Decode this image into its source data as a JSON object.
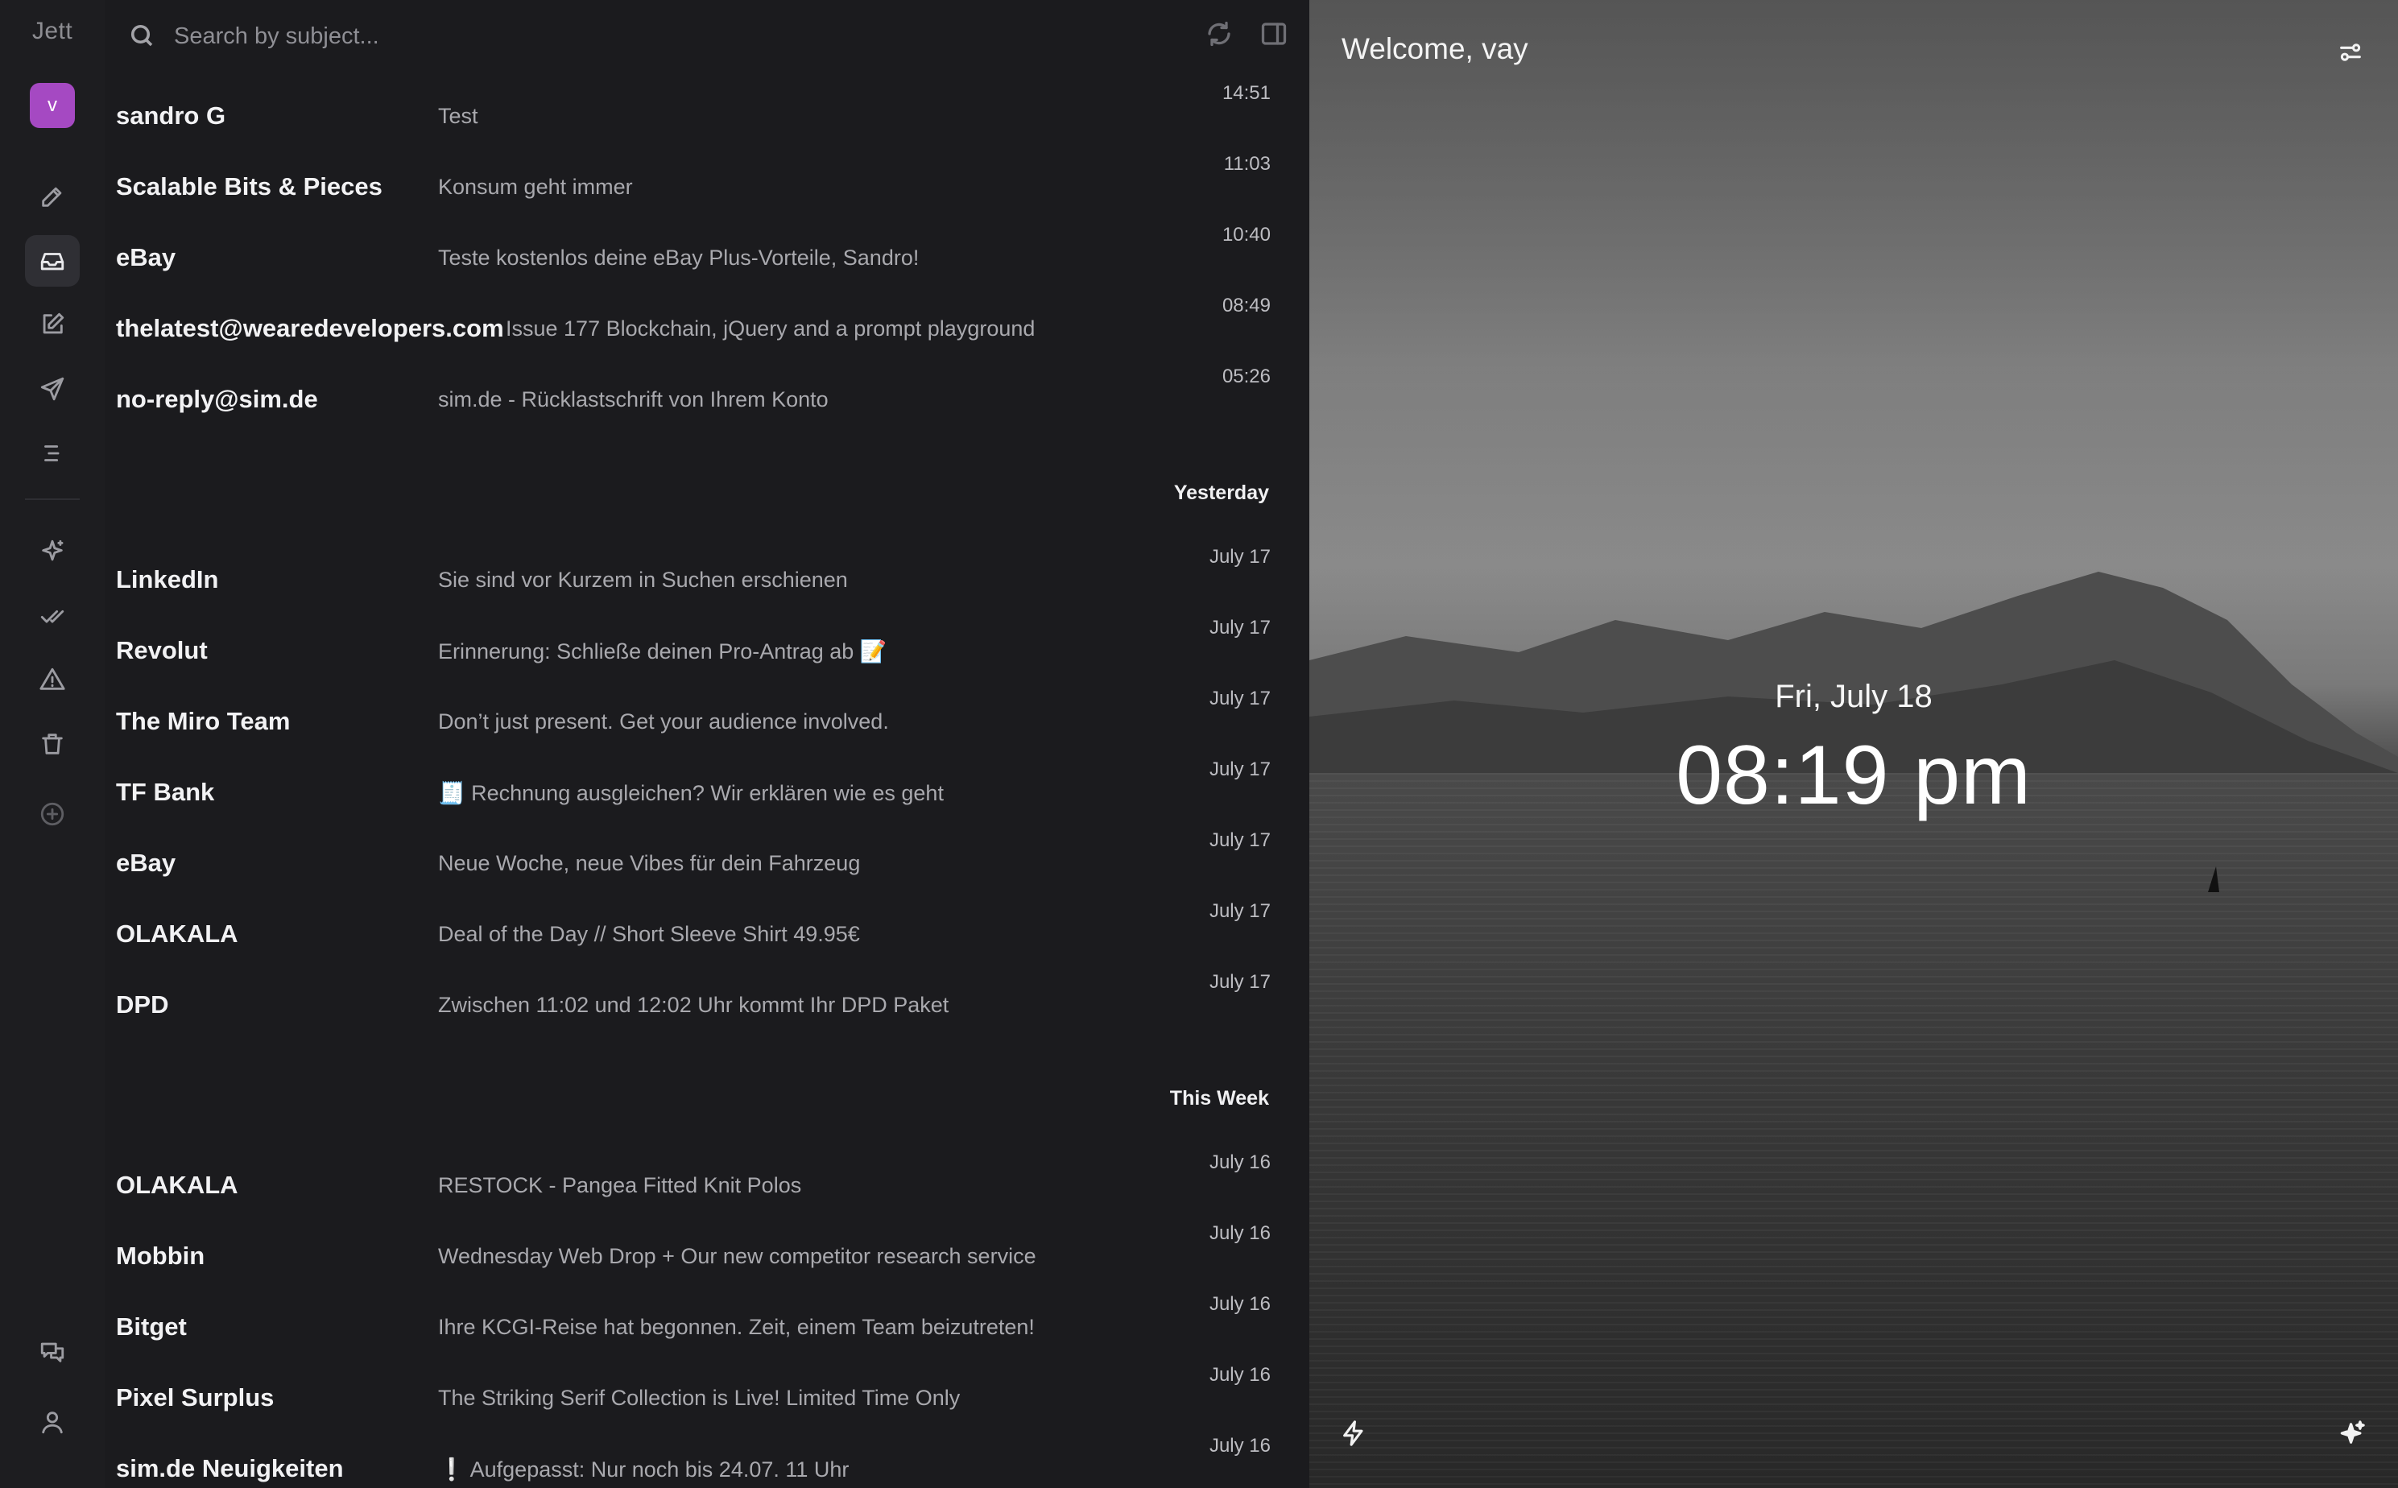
{
  "app": {
    "name": "Jett",
    "avatar_initial": "v"
  },
  "search": {
    "placeholder": "Search by subject..."
  },
  "emails_today": [
    {
      "sender": "sandro G",
      "subject": "Test",
      "time": "14:51"
    },
    {
      "sender": "Scalable Bits & Pieces",
      "subject": "Konsum geht immer",
      "time": "11:03"
    },
    {
      "sender": "eBay",
      "subject": "Teste kostenlos deine eBay Plus-Vorteile, Sandro!",
      "time": "10:40"
    },
    {
      "sender": "thelatest@wearedevelopers.com",
      "subject": "Issue 177 Blockchain, jQuery and a prompt playground",
      "time": "08:49"
    },
    {
      "sender": "no-reply@sim.de",
      "subject": "sim.de - Rücklastschrift von Ihrem Konto",
      "time": "05:26"
    }
  ],
  "group_yesterday": "Yesterday",
  "emails_yesterday": [
    {
      "sender": "LinkedIn",
      "subject": "Sie sind vor Kurzem in Suchen erschienen",
      "time": "July 17"
    },
    {
      "sender": "Revolut",
      "subject": "Erinnerung: Schließe deinen Pro-Antrag ab 📝",
      "time": "July 17"
    },
    {
      "sender": "The Miro Team",
      "subject": "Don’t just present. Get your audience involved.",
      "time": "July 17"
    },
    {
      "sender": "TF Bank",
      "subject": "🧾 Rechnung ausgleichen? Wir erklären wie es geht",
      "time": "July 17"
    },
    {
      "sender": "eBay",
      "subject": "Neue Woche, neue Vibes für dein Fahrzeug",
      "time": "July 17"
    },
    {
      "sender": "OLAKALA",
      "subject": "Deal of the Day // Short Sleeve Shirt 49.95€",
      "time": "July 17"
    },
    {
      "sender": "DPD",
      "subject": "Zwischen 11:02 und 12:02 Uhr kommt Ihr DPD Paket",
      "time": "July 17"
    }
  ],
  "group_this_week": "This Week",
  "emails_this_week": [
    {
      "sender": "OLAKALA",
      "subject": "RESTOCK - Pangea Fitted Knit Polos",
      "time": "July 16"
    },
    {
      "sender": "Mobbin",
      "subject": "Wednesday Web Drop + Our new competitor research service",
      "time": "July 16"
    },
    {
      "sender": "Bitget",
      "subject": "Ihre KCGI-Reise hat begonnen. Zeit, einem Team beizutreten!",
      "time": "July 16"
    },
    {
      "sender": "Pixel Surplus",
      "subject": "The Striking Serif Collection is Live! Limited Time Only",
      "time": "July 16"
    },
    {
      "sender": "sim.de Neuigkeiten",
      "subject": "❕ Aufgepasst: Nur noch bis 24.07. 11 Uhr",
      "time": "July 16"
    }
  ],
  "welcome": {
    "title": "Welcome, vay",
    "date": "Fri, July 18",
    "time": "08:19 pm"
  },
  "colors": {
    "avatar": "#a549c2",
    "background": "#1b1b1e"
  }
}
